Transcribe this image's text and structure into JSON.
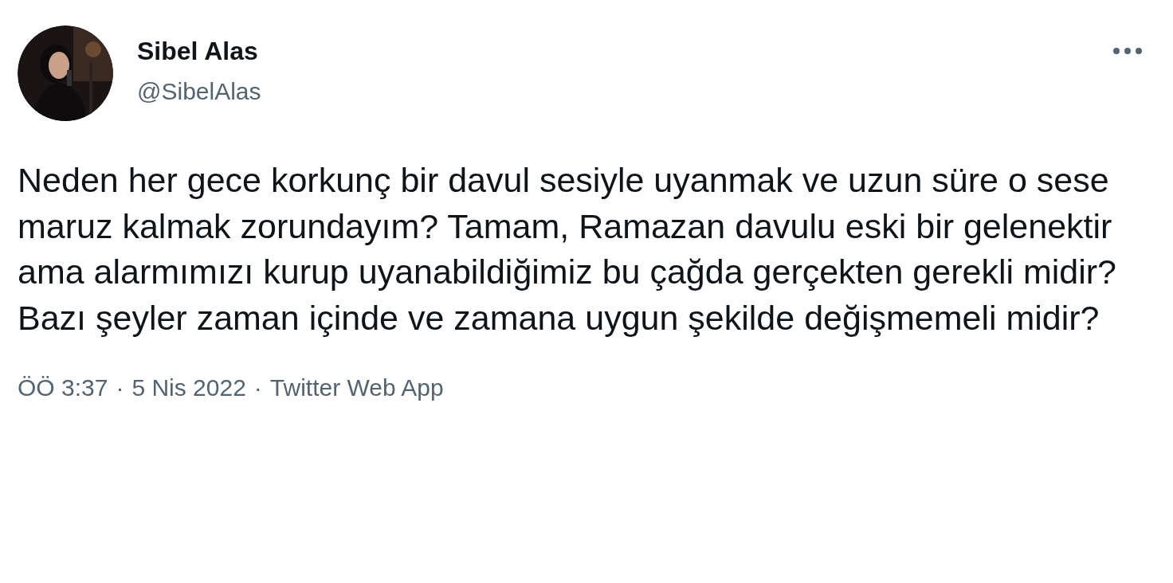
{
  "author": {
    "name": "Sibel Alas",
    "handle": "@SibelAlas"
  },
  "tweet": {
    "text": "Neden her gece korkunç bir davul sesiyle uyanmak ve uzun süre o sese maruz kalmak zorundayım? Tamam, Ramazan davulu eski bir gelenektir ama alarmımızı kurup uyanabildiğimiz bu çağda gerçekten gerekli midir?  Bazı şeyler zaman içinde ve zamana uygun şekilde değişmemeli midir?"
  },
  "meta": {
    "time": "ÖÖ 3:37",
    "separator": "·",
    "date": "5 Nis 2022",
    "source": "Twitter Web App"
  }
}
